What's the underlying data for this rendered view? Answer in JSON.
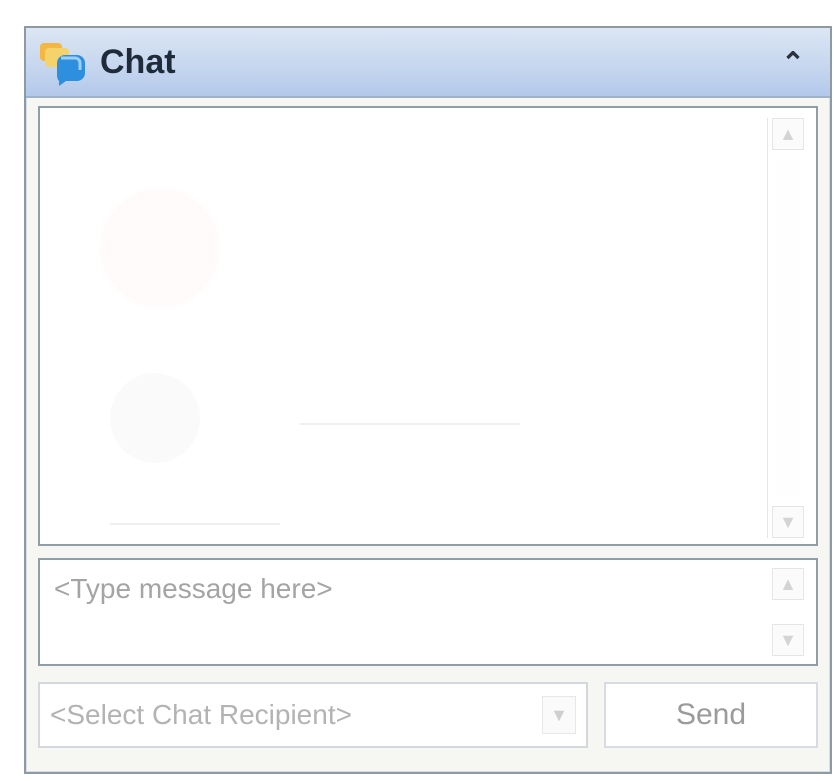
{
  "window": {
    "title": "Chat",
    "icon": "chat-bubbles-icon",
    "collapse_icon": "double-chevron-up-icon",
    "colors": {
      "header_top": "#dce6f4",
      "header_bottom": "#b3c9ea",
      "title_text": "#1f2a3b",
      "border": "#8f9ea8"
    }
  },
  "message_area": {
    "scroll_up_icon": "scroll-up-arrow-icon",
    "scroll_down_icon": "scroll-down-arrow-icon"
  },
  "compose": {
    "placeholder": "<Type message here>"
  },
  "recipient_select": {
    "selected": "<Select Chat Recipient>",
    "dropdown_icon": "chevron-down-icon"
  },
  "actions": {
    "send_label": "Send"
  }
}
